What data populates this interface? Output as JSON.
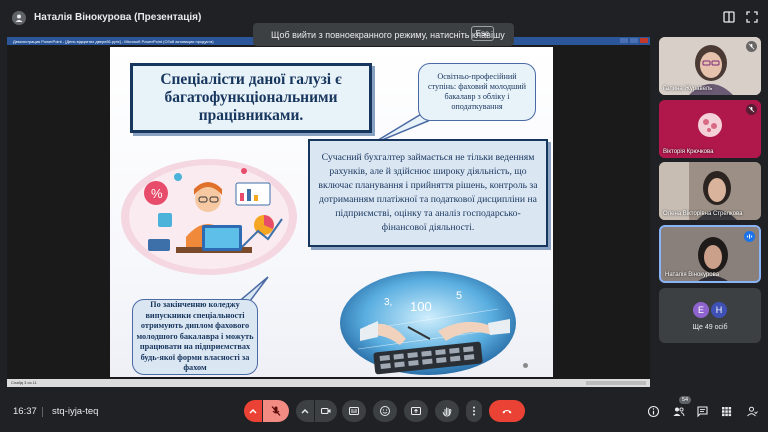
{
  "presenter": {
    "name": "Наталія Вінокурова (Презентація)"
  },
  "toast": {
    "text": "Щоб вийти з повноекранного режиму, натисніть клавішу",
    "key": "Esc"
  },
  "powerpoint": {
    "window_title": "Демонстрация PowerPoint - [День відкритих дверей1.pptx] - Microsoft PowerPoint (Сбой активации продукта)",
    "status": "Слайд 3 из 11"
  },
  "slide": {
    "title": "Спеціалісти даної галузі є багатофункціональними працівниками.",
    "bubble_top": "Освітньо-професійний ступінь: фаховий молодший бакалавр з обліку і оподаткування",
    "main_text": "Сучасний бухгалтер займається не тільки веденням рахунків, але й здійснює широку діяльність, що включає планування і прийняття рішень, контроль за дотриманням платіжної та податкової дисципліни на підприємстві, оцінку та аналіз господарсько-фінансової діяльності.",
    "bubble_bottom": "По закінченню коледжу випускники спеціальності отримують диплом фахового молодшого бакалавра і можуть працювати на підприємствах будь-якої форми власності за фахом",
    "illus_numbers": [
      "3,",
      "100",
      "5"
    ]
  },
  "participants": [
    {
      "name": "Галина Журавель",
      "muted": true,
      "bg": "#c9b9b2"
    },
    {
      "name": "Вікторія Крючкова",
      "muted": true,
      "bg": "#b0174a"
    },
    {
      "name": "Олена Вікторівна Стрелкова",
      "muted": false,
      "bg": "#8c8074"
    },
    {
      "name": "Наталія Вінокурова",
      "muted": false,
      "bg": "#7e7470"
    }
  ],
  "more": {
    "avatars": [
      "E",
      "H"
    ],
    "text": "Ще 49 осіб",
    "colors": [
      "#8e63ce",
      "#3f51b5"
    ]
  },
  "bottom": {
    "time": "16:37",
    "meeting_code": "stq-iyja-teq",
    "people_count": "54"
  },
  "colors": {
    "accent_red": "#ea4335",
    "slide_navy": "#17365d",
    "meet_bg": "#202124"
  }
}
